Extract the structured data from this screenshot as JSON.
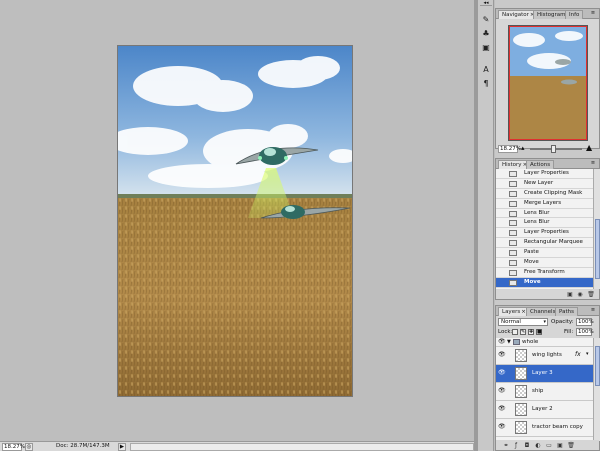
{
  "status": {
    "zoom": "18.27%",
    "doc": "Doc: 28.7M/147.3M"
  },
  "navigator": {
    "tabs": [
      {
        "label": "Navigator",
        "active": true
      },
      {
        "label": "Histogram",
        "active": false
      },
      {
        "label": "Info",
        "active": false
      }
    ],
    "zoom": "18.27%"
  },
  "history": {
    "tabs": [
      {
        "label": "History",
        "active": true
      },
      {
        "label": "Actions",
        "active": false
      }
    ],
    "items": [
      {
        "label": "Layer Properties",
        "icon": "step-icon"
      },
      {
        "label": "New Layer",
        "icon": "step-icon"
      },
      {
        "label": "Create Clipping Mask",
        "icon": "step-icon"
      },
      {
        "label": "Merge Layers",
        "icon": "step-icon"
      },
      {
        "label": "Lens Blur",
        "icon": "step-icon"
      },
      {
        "label": "Lens Blur",
        "icon": "step-icon"
      },
      {
        "label": "Layer Properties",
        "icon": "step-icon"
      },
      {
        "label": "Rectangular Marquee",
        "icon": "marquee-icon"
      },
      {
        "label": "Paste",
        "icon": "step-icon"
      },
      {
        "label": "Move",
        "icon": "move-icon"
      },
      {
        "label": "Free Transform",
        "icon": "step-icon"
      },
      {
        "label": "Move",
        "icon": "move-icon",
        "selected": true
      }
    ]
  },
  "layers": {
    "tabs": [
      {
        "label": "Layers",
        "active": true
      },
      {
        "label": "Channels",
        "active": false
      },
      {
        "label": "Paths",
        "active": false
      }
    ],
    "blend_mode": "Normal",
    "opacity_label": "Opacity:",
    "opacity": "100%",
    "lock_label": "Lock:",
    "fill_label": "Fill:",
    "fill": "100%",
    "items": [
      {
        "name": "whole",
        "type": "group"
      },
      {
        "name": "wing lights",
        "type": "layer",
        "fx": "fx"
      },
      {
        "name": "Layer 3",
        "type": "layer",
        "selected": true
      },
      {
        "name": "ship",
        "type": "layer"
      },
      {
        "name": "Layer 2",
        "type": "layer"
      },
      {
        "name": "tractor beam copy",
        "type": "layer"
      }
    ]
  },
  "colors": {
    "selection": "#3568c8",
    "panel": "#d6d6d6",
    "workspace": "#bebebe"
  }
}
